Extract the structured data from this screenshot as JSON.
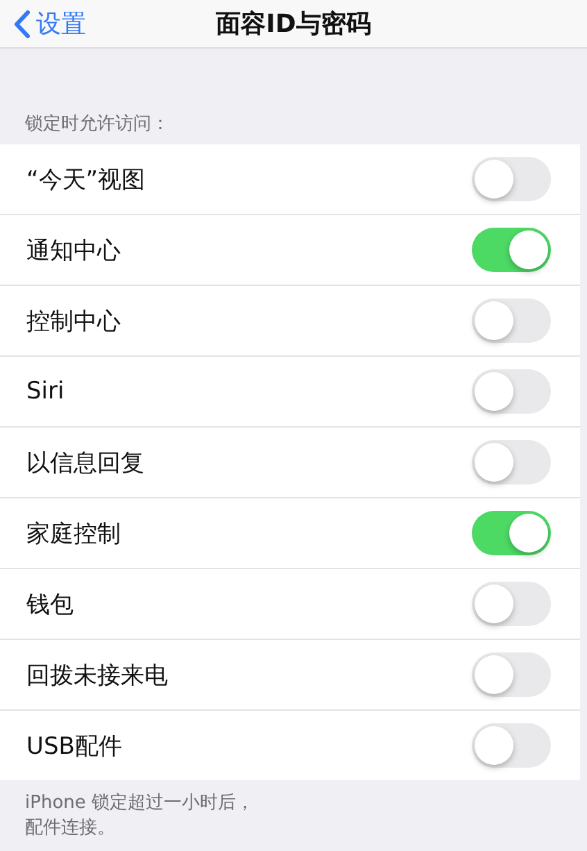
{
  "nav": {
    "back": "设置",
    "title": "面容ID与密码"
  },
  "section_header": "锁定时允许访问：",
  "rows": [
    {
      "label": "“今天”视图",
      "on": false
    },
    {
      "label": "通知中心",
      "on": true
    },
    {
      "label": "控制中心",
      "on": false
    },
    {
      "label": "Siri",
      "on": false
    },
    {
      "label": "以信息回复",
      "on": false
    },
    {
      "label": "家庭控制",
      "on": true
    },
    {
      "label": "钱包",
      "on": false
    },
    {
      "label": "回拨未接来电",
      "on": false
    },
    {
      "label": "USB配件",
      "on": false
    }
  ],
  "footer_lines": [
    "iPhone 锁定超过一小时后，",
    "配件连接。"
  ]
}
